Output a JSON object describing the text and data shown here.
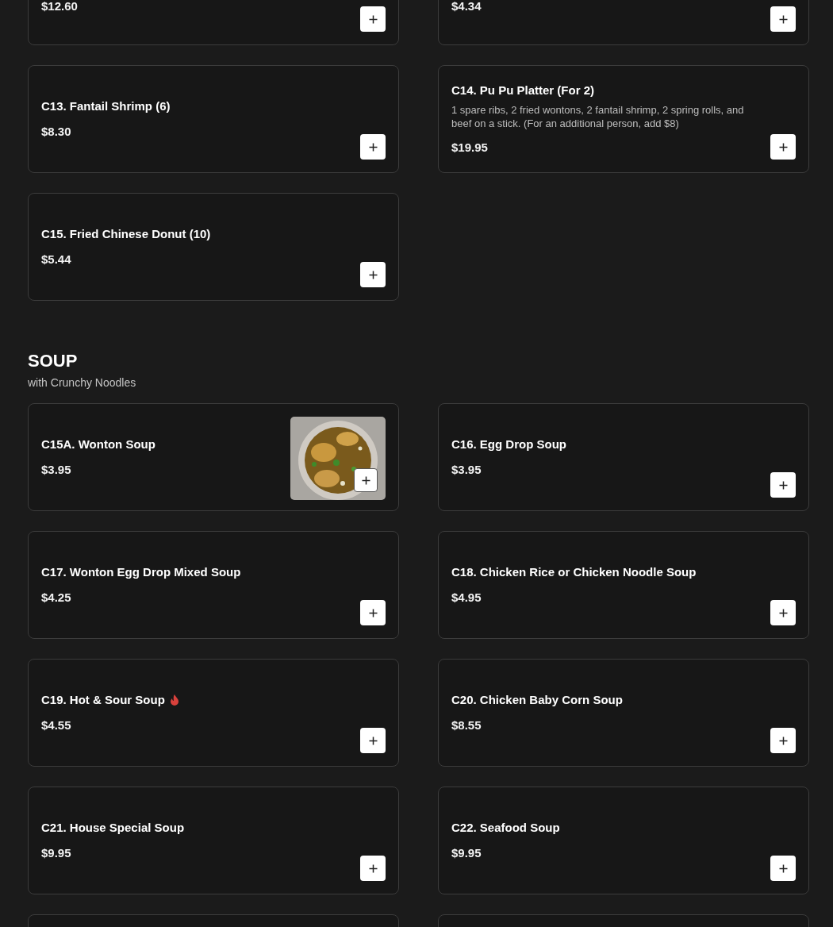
{
  "sections": [
    {
      "clipped_row": [
        {
          "kind": "partial",
          "price": "$12.60"
        },
        {
          "kind": "partial",
          "price": "$4.34"
        }
      ],
      "items": [
        {
          "kind": "dish",
          "name": "C13. Fantail Shrimp (6)",
          "price": "$8.30",
          "spicy": false
        },
        {
          "kind": "dish",
          "name": "C14. Pu Pu Platter (For 2)",
          "description": "1 spare ribs, 2 fried wontons, 2 fantail shrimp, 2 spring rolls, and beef on a stick. (For an additional person, add $8)",
          "price": "$19.95",
          "spicy": false
        },
        {
          "kind": "dish",
          "name": "C15. Fried Chinese Donut (10)",
          "price": "$5.44",
          "spicy": false
        }
      ]
    },
    {
      "title": "SOUP",
      "subtitle": "with Crunchy Noodles",
      "items": [
        {
          "name": "C15A. Wonton Soup",
          "price": "$3.95",
          "spicy": false
        },
        {
          "kind": "dish",
          "name": "C16. Egg Drop Soup",
          "price": "$3.95",
          "spicy": false
        },
        {
          "kind": "dish",
          "name": "C17. Wonton Egg Drop Mixed Soup",
          "price": "$4.25",
          "spicy": false
        },
        {
          "kind": "dish",
          "name": "C18. Chicken Rice or Chicken Noodle Soup",
          "price": "$4.95",
          "spicy": false
        },
        {
          "kind": "dish",
          "name": "C19. Hot & Sour Soup",
          "price": "$4.55",
          "spicy": true
        },
        {
          "kind": "dish",
          "name": "C20. Chicken Baby Corn Soup",
          "price": "$8.55",
          "spicy": false
        },
        {
          "kind": "dish",
          "name": "C21. House Special Soup",
          "price": "$9.95",
          "spicy": false
        },
        {
          "kind": "dish",
          "name": "C22. Seafood Soup",
          "price": "$9.95",
          "spicy": false
        },
        {
          "kind": "clipped"
        },
        {
          "kind": "clipped"
        }
      ]
    }
  ]
}
